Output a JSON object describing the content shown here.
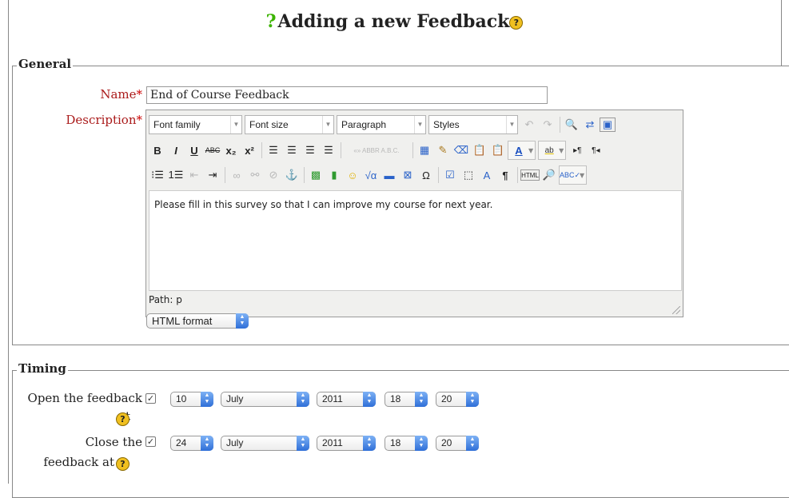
{
  "title": "Adding a new Feedback",
  "general": {
    "legend": "General",
    "name_label": "Name",
    "name_value": "End of Course Feedback",
    "description_label": "Description",
    "required_mark": "*"
  },
  "editor": {
    "font_family": "Font family",
    "font_size": "Font size",
    "paragraph": "Paragraph",
    "styles": "Styles",
    "content": "Please fill in this survey so that I can improve my course for next year.",
    "path": "Path: p",
    "format": "HTML format"
  },
  "timing": {
    "legend": "Timing",
    "open_label_1": "Open the feedback",
    "open_label_2": "at",
    "close_label_1": "Close the",
    "close_label_2": "feedback at",
    "open": {
      "checked": true,
      "day": "10",
      "month": "July",
      "year": "2011",
      "hour": "18",
      "minute": "20"
    },
    "close": {
      "checked": true,
      "day": "24",
      "month": "July",
      "year": "2011",
      "hour": "18",
      "minute": "20"
    }
  },
  "icons": {
    "help": "?",
    "check": "✓"
  }
}
